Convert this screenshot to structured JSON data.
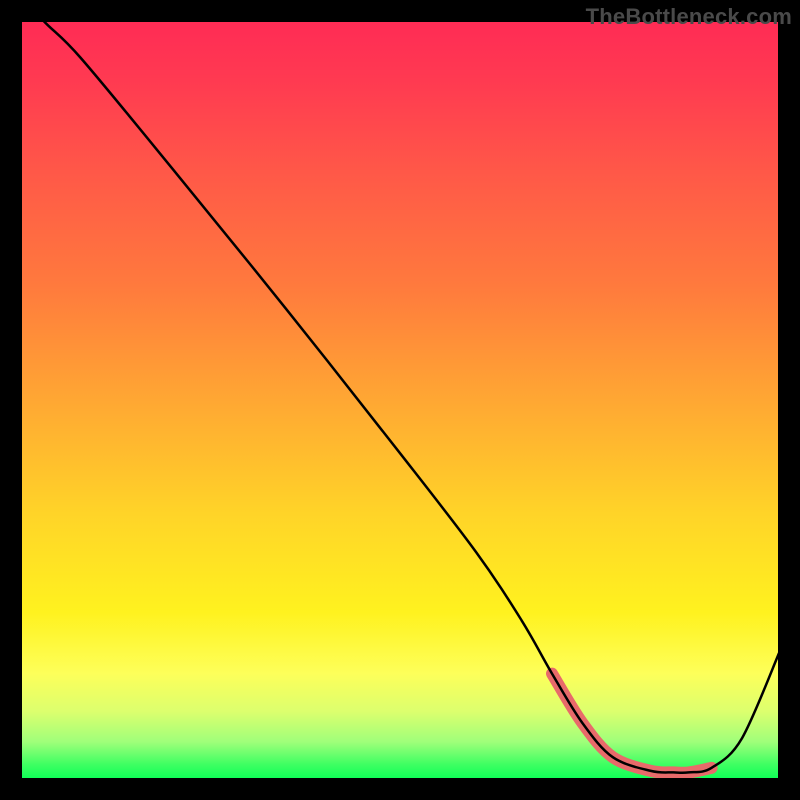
{
  "watermark": "TheBottleneck.com",
  "colors": {
    "curve": "#000000",
    "highlight": "#e86a6a"
  },
  "chart_data": {
    "type": "line",
    "title": "",
    "xlabel": "",
    "ylabel": "",
    "xlim": [
      0,
      100
    ],
    "ylim": [
      0,
      100
    ],
    "x": [
      0,
      3,
      8,
      20,
      35,
      50,
      60,
      66,
      70,
      74,
      78,
      83,
      86,
      88,
      91,
      95,
      100
    ],
    "values": [
      104,
      100,
      95,
      80.5,
      62,
      43,
      30,
      21,
      14,
      7.5,
      3,
      1.2,
      1.0,
      1.0,
      1.6,
      5.5,
      17
    ],
    "highlight_range": [
      70,
      91
    ],
    "grid": false,
    "legend": false
  }
}
